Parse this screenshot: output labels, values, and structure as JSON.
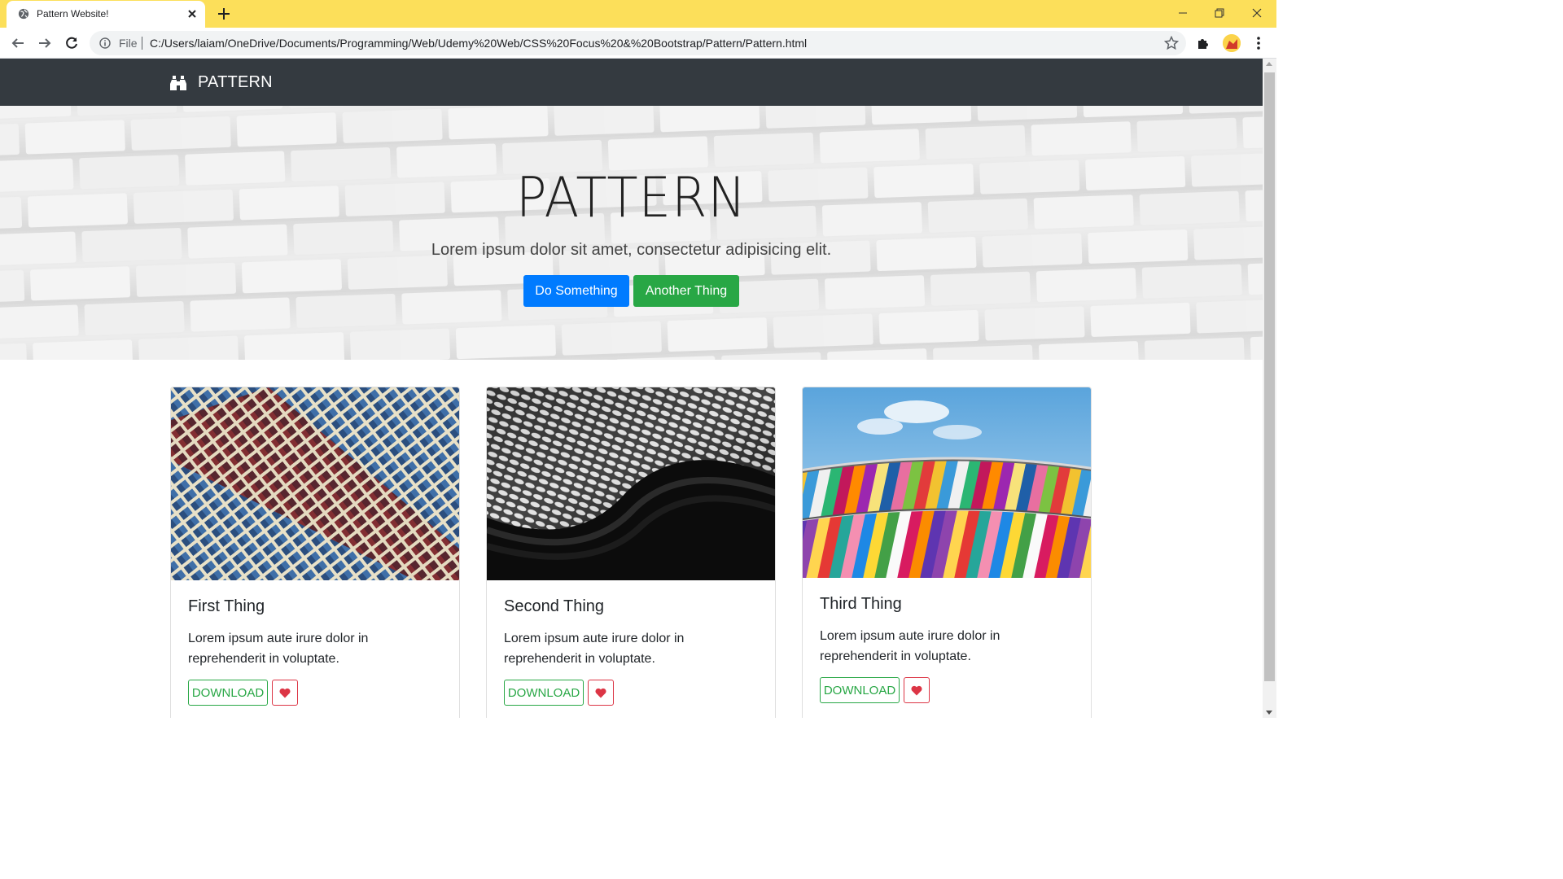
{
  "browser": {
    "tab_title": "Pattern Website!",
    "scheme_label": "File",
    "url": "C:/Users/laiam/OneDrive/Documents/Programming/Web/Udemy%20Web/CSS%20Focus%20&%20Bootstrap/Pattern/Pattern.html",
    "accent_color": "#fcdf5a"
  },
  "navbar": {
    "brand_icon": "binoculars-icon",
    "brand": "PATTERN",
    "background": "#343a40"
  },
  "hero": {
    "title": "PATTERN",
    "lead": "Lorem ipsum dolor sit amet, consectetur adipisicing elit.",
    "primary_button": "Do Something",
    "secondary_button": "Another Thing"
  },
  "cards": [
    {
      "title": "First Thing",
      "text": "Lorem ipsum aute irure dolor in reprehenderit in voluptate.",
      "download": "DOWNLOAD",
      "heart_icon": "heart-icon"
    },
    {
      "title": "Second Thing",
      "text": "Lorem ipsum aute irure dolor in reprehenderit in voluptate.",
      "download": "DOWNLOAD",
      "heart_icon": "heart-icon"
    },
    {
      "title": "Third Thing",
      "text": "Lorem ipsum aute irure dolor in reprehenderit in voluptate.",
      "download": "DOWNLOAD",
      "heart_icon": "heart-icon"
    }
  ],
  "colors": {
    "primary": "#007bff",
    "success": "#28a745",
    "danger": "#dc3545"
  }
}
